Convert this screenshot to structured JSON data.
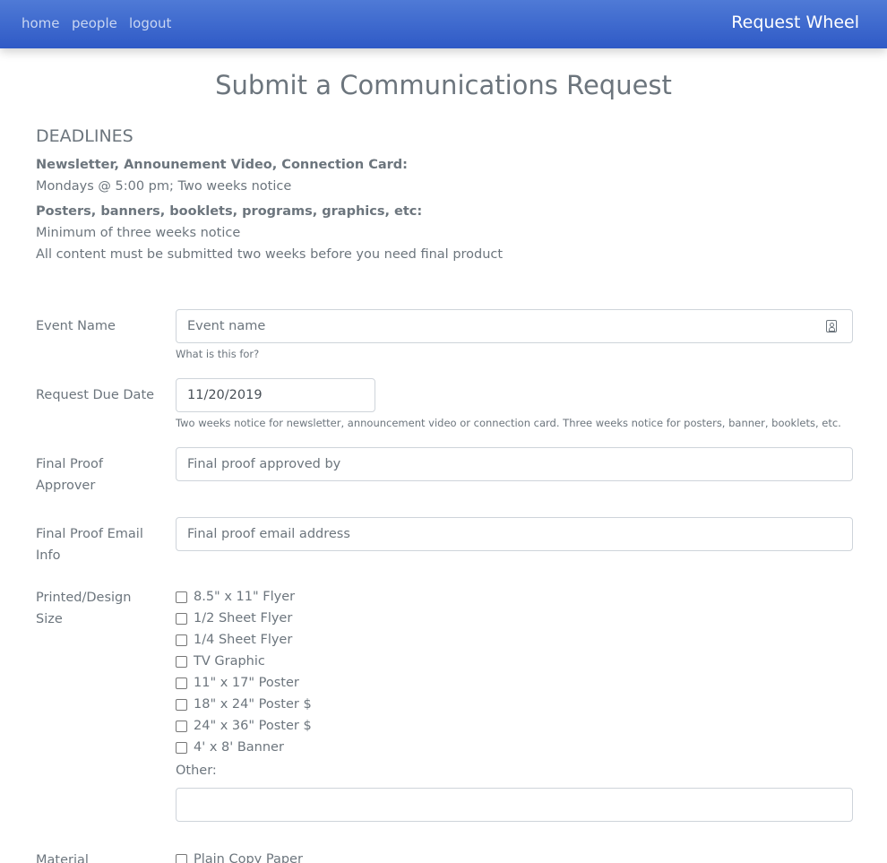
{
  "nav": {
    "links": [
      "home",
      "people",
      "logout"
    ],
    "brand": "Request Wheel"
  },
  "page_title": "Submit a Communications Request",
  "deadlines": {
    "heading": "DEADLINES",
    "items": [
      {
        "title": "Newsletter, Announement Video, Connection Card:",
        "lines": [
          "Mondays @ 5:00 pm; Two weeks notice"
        ]
      },
      {
        "title": "Posters, banners, booklets, programs, graphics, etc:",
        "lines": [
          "Minimum of three weeks notice",
          "All content must be submitted two weeks before you need final product"
        ]
      }
    ]
  },
  "form": {
    "event_name": {
      "label": "Event Name",
      "placeholder": "Event name",
      "value": "",
      "help": "What is this for?"
    },
    "due_date": {
      "label": "Request Due Date",
      "value": "11/20/2019",
      "help": "Two weeks notice for newsletter, announcement video or connection card. Three weeks notice for posters, banner, booklets, etc."
    },
    "approver": {
      "label": "Final Proof Approver",
      "placeholder": "Final proof approved by",
      "value": ""
    },
    "email": {
      "label": "Final Proof Email Info",
      "placeholder": "Final proof email address",
      "value": ""
    },
    "size": {
      "label": "Printed/Design Size",
      "options": [
        "8.5\" x 11\" Flyer",
        "1/2 Sheet Flyer",
        "1/4 Sheet Flyer",
        "TV Graphic",
        "11\" x 17\" Poster",
        "18\" x 24\" Poster $",
        "24\" x 36\" Poster $",
        "4' x 8' Banner"
      ],
      "other_label": "Other:",
      "other_value": ""
    },
    "material": {
      "label": "Material",
      "options": [
        "Plain Copy Paper"
      ]
    }
  },
  "icons": {
    "event_name_field": "contact-card-icon"
  },
  "colors": {
    "navbar": "#3f68d0",
    "text": "#6c757d",
    "border": "#ced4da"
  }
}
